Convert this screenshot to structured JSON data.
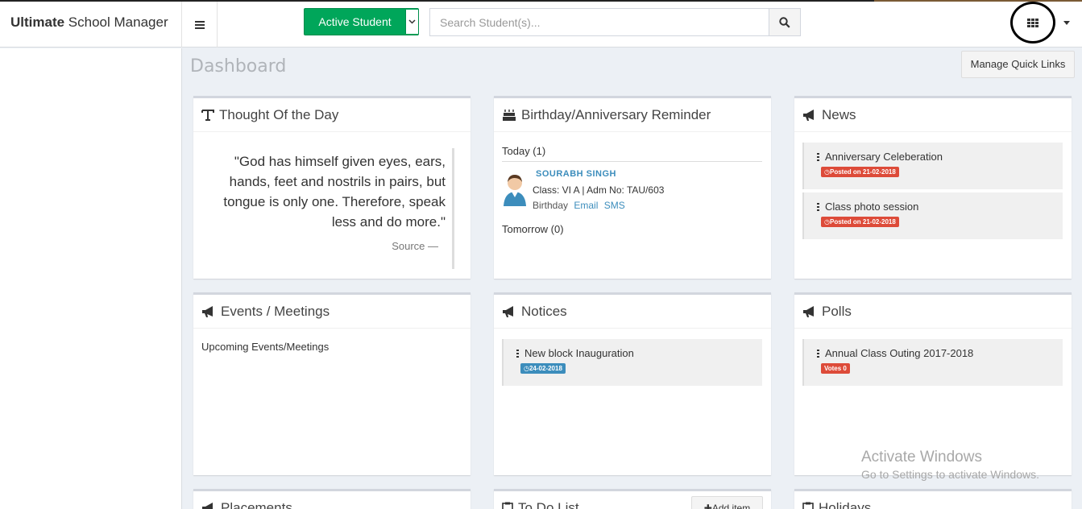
{
  "brand": {
    "bold": "Ultimate",
    "rest": " School Manager"
  },
  "header": {
    "student_filter_label": "Active Student",
    "search_placeholder": "Search Student(s)..."
  },
  "page": {
    "title": "Dashboard",
    "quick_links": "Manage Quick Links"
  },
  "thought": {
    "title": "Thought Of the Day",
    "quote": "\"God has himself given eyes, ears, hands, feet and nostrils in pairs, but tongue is only one. Therefore, speak less and do more.\"",
    "source": "Source —"
  },
  "birthday": {
    "title": "Birthday/Anniversary Reminder",
    "today": "Today (1)",
    "person": {
      "name": "SOURABH SINGH",
      "details": "Class: VI A | Adm No: TAU/603",
      "type": "Birthday",
      "email": "Email",
      "sms": "SMS"
    },
    "tomorrow": "Tomorrow (0)"
  },
  "news": {
    "title": "News",
    "items": [
      {
        "title": "Anniversary Celeberation",
        "badge": "Posted on 21-02-2018"
      },
      {
        "title": "Class photo session",
        "badge": "Posted on 21-02-2018"
      }
    ]
  },
  "events": {
    "title": "Events / Meetings",
    "upcoming": "Upcoming Events/Meetings"
  },
  "notices": {
    "title": "Notices",
    "items": [
      {
        "title": "New block Inauguration",
        "badge": "24-02-2018"
      }
    ]
  },
  "polls": {
    "title": "Polls",
    "items": [
      {
        "title": "Annual Class Outing 2017-2018",
        "badge": "Votes 0"
      }
    ]
  },
  "placements": {
    "title": "Placements"
  },
  "todo": {
    "title": "To Do List",
    "add_item": "Add item"
  },
  "holidays": {
    "title": "Holidays"
  },
  "watermark": {
    "line1": "Activate Windows",
    "line2": "Go to Settings to activate Windows."
  },
  "colors": {
    "green": "#00a65a",
    "blue": "#3c8dbc",
    "red": "#dd4b39"
  }
}
